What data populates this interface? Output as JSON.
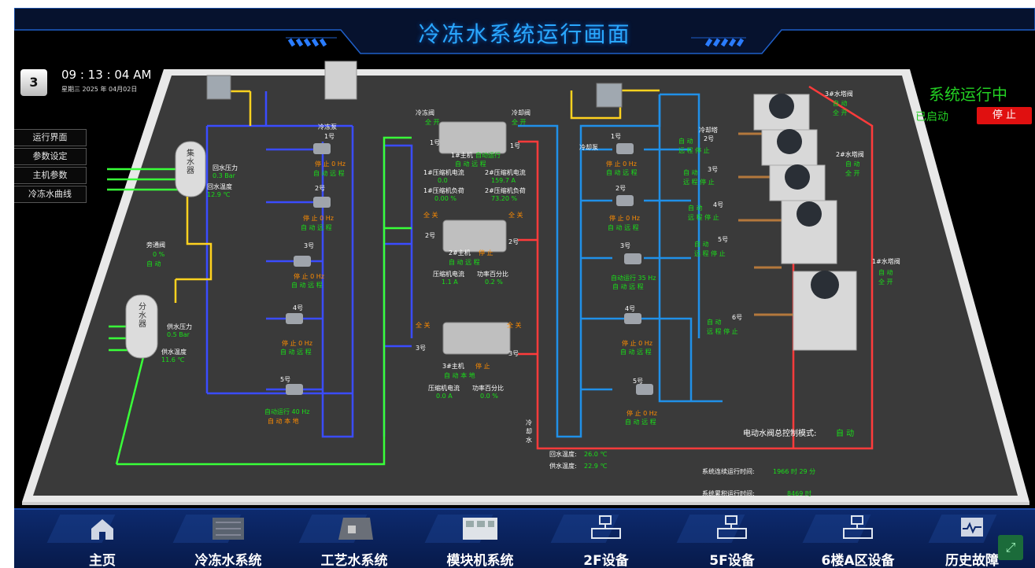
{
  "title": "冷冻水系统运行画面",
  "clock": {
    "time": "09 : 13 : 04  AM",
    "date": "星期三  2025 年 04月02日",
    "day": "3"
  },
  "menu": [
    "运行界面",
    "参数设定",
    "主机参数",
    "冷冻水曲线"
  ],
  "status": {
    "running": "系统运行中",
    "started": "已启动",
    "stop": "停 止"
  },
  "collector": {
    "name": "集\n水\n器",
    "p_label": "回水压力",
    "p_val": "0.3 Bar",
    "t_label": "回水温度",
    "t_val": "12.9 ℃"
  },
  "distributor": {
    "name": "分\n水\n器",
    "p_label": "供水压力",
    "p_val": "0.5 Bar",
    "t_label": "供水温度",
    "t_val": "11.6 ℃"
  },
  "bypass": {
    "label": "旁通阀",
    "val": "0 %",
    "mode": "自 动"
  },
  "chw_pump_title": "冷冻泵",
  "chw_pumps": [
    {
      "no": "1号",
      "state": "停 止    0 Hz",
      "mode": "自 动  远 程"
    },
    {
      "no": "2号",
      "state": "停 止    0 Hz",
      "mode": "自 动  远 程"
    },
    {
      "no": "3号",
      "state": "停 止    0 Hz",
      "mode": "自 动  远 程"
    },
    {
      "no": "4号",
      "state": "停 止    0 Hz",
      "mode": "自 动  远 程"
    },
    {
      "no": "5号",
      "state": "自动运行  40 Hz",
      "mode": "自 动  本 地"
    }
  ],
  "valves": {
    "chw": "冷冻阀",
    "cw": "冷却阀",
    "full_open": "全 开",
    "full_close": "全 关"
  },
  "chillers": [
    {
      "name": "1#主机",
      "run": "自动运行",
      "mode": "自 动  远 程",
      "c1": "1#压缩机电流",
      "c1v": "0.0",
      "c2": "2#压缩机电流",
      "c2v": "159.7 A",
      "l1": "1#压缩机负荷",
      "l1v": "0.00 %",
      "l2": "2#压缩机负荷",
      "l2v": "73.20 %",
      "left": "1号",
      "right": "1号"
    },
    {
      "name": "2#主机",
      "run": "停 止",
      "mode": "自 动    远 程",
      "c1": "压缩机电流",
      "c1v": "1.1 A",
      "l1": "功率百分比",
      "l1v": "0.2 %",
      "left": "2号",
      "right": "2号"
    },
    {
      "name": "3#主机",
      "run": "停 止",
      "mode": "自 动    本 地",
      "c1": "压缩机电流",
      "c1v": "0.0 A",
      "l1": "功率百分比",
      "l1v": "0.0 %",
      "left": "3号",
      "right": "3号"
    }
  ],
  "cw_pump_title": "冷却泵",
  "cw_pumps": [
    {
      "no": "1号",
      "state": "停 止    0 Hz",
      "mode": "自 动  远 程"
    },
    {
      "no": "2号",
      "state": "停 止    0 Hz",
      "mode": "自 动  远 程"
    },
    {
      "no": "3号",
      "state": "自动运行  35 Hz",
      "mode": "自 动  远 程"
    },
    {
      "no": "4号",
      "state": "停 止    0 Hz",
      "mode": "自 动  远 程"
    },
    {
      "no": "5号",
      "state": "停 止    0 Hz",
      "mode": "自 动  远 程"
    }
  ],
  "tower_title": "冷却塔",
  "towers": [
    {
      "no": "2号",
      "mode": "自 动",
      "state": "远 程    停 止"
    },
    {
      "no": "3号",
      "mode": "自 动",
      "state": "远 程    停 止"
    },
    {
      "no": "4号",
      "mode": "自 动",
      "state": "远 程    停 止"
    },
    {
      "no": "5号",
      "mode": "自 动",
      "state": "远 程    停 止"
    },
    {
      "no": "6号",
      "mode": "自 动",
      "state": "远 程    停 止"
    }
  ],
  "tower_valves": [
    {
      "name": "3#水塔阀",
      "mode": "自 动",
      "state": "全 开"
    },
    {
      "name": "2#水塔阀",
      "mode": "自 动",
      "state": "全 开"
    },
    {
      "name": "1#水塔阀",
      "mode": "自 动",
      "state": "全 开"
    }
  ],
  "cw_label": "冷\n却\n水",
  "cw_return": "回水温度: ",
  "cw_return_v": "26.0 ℃",
  "cw_supply": "供水温度: ",
  "cw_supply_v": "22.9 ℃",
  "valve_mode_label": "电动水阀总控制模式: ",
  "valve_mode_val": "自 动",
  "run_cont_label": "系统连续运行时间: ",
  "run_cont_val": "1966 时  29 分",
  "run_total_label": "系统累积运行时间: ",
  "run_total_val": "8469 时",
  "nav": [
    "主页",
    "冷冻水系统",
    "工艺水系统",
    "模块机系统",
    "2F设备",
    "5F设备",
    "6楼A区设备",
    "历史故障"
  ]
}
